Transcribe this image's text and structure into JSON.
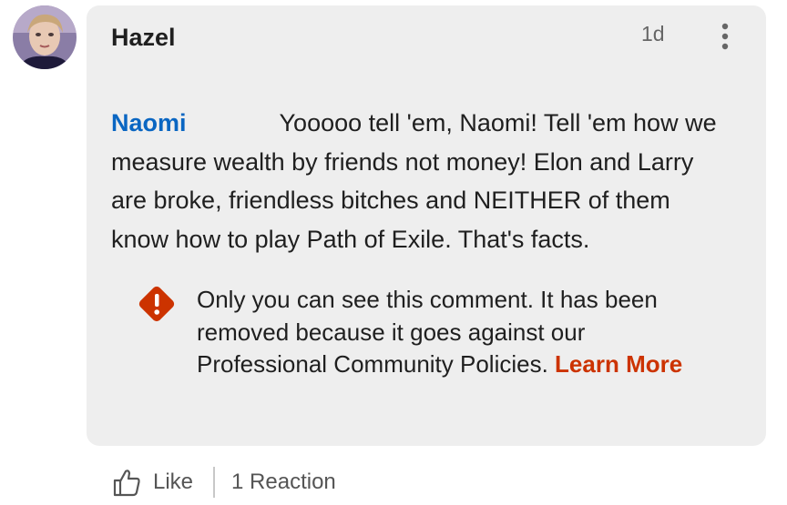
{
  "comment": {
    "author": "Hazel",
    "timestamp": "1d",
    "mention": "Naomi",
    "body": "Yooooo tell 'em, Naomi! Tell 'em how we measure wealth by friends not money! Elon and Larry are broke, friendless bitches and NEITHER of them know how to play Path of Exile. That's facts."
  },
  "notice": {
    "icon": "warning-diamond-icon",
    "text": "Only you can see this comment. It has been removed because it goes against our Professional Community Policies. ",
    "link_label": "Learn More"
  },
  "actions": {
    "like_label": "Like",
    "reactions_label": "1 Reaction"
  },
  "colors": {
    "mention": "#0a66c2",
    "warning": "#cc3300",
    "bubble": "#eeeeee"
  }
}
